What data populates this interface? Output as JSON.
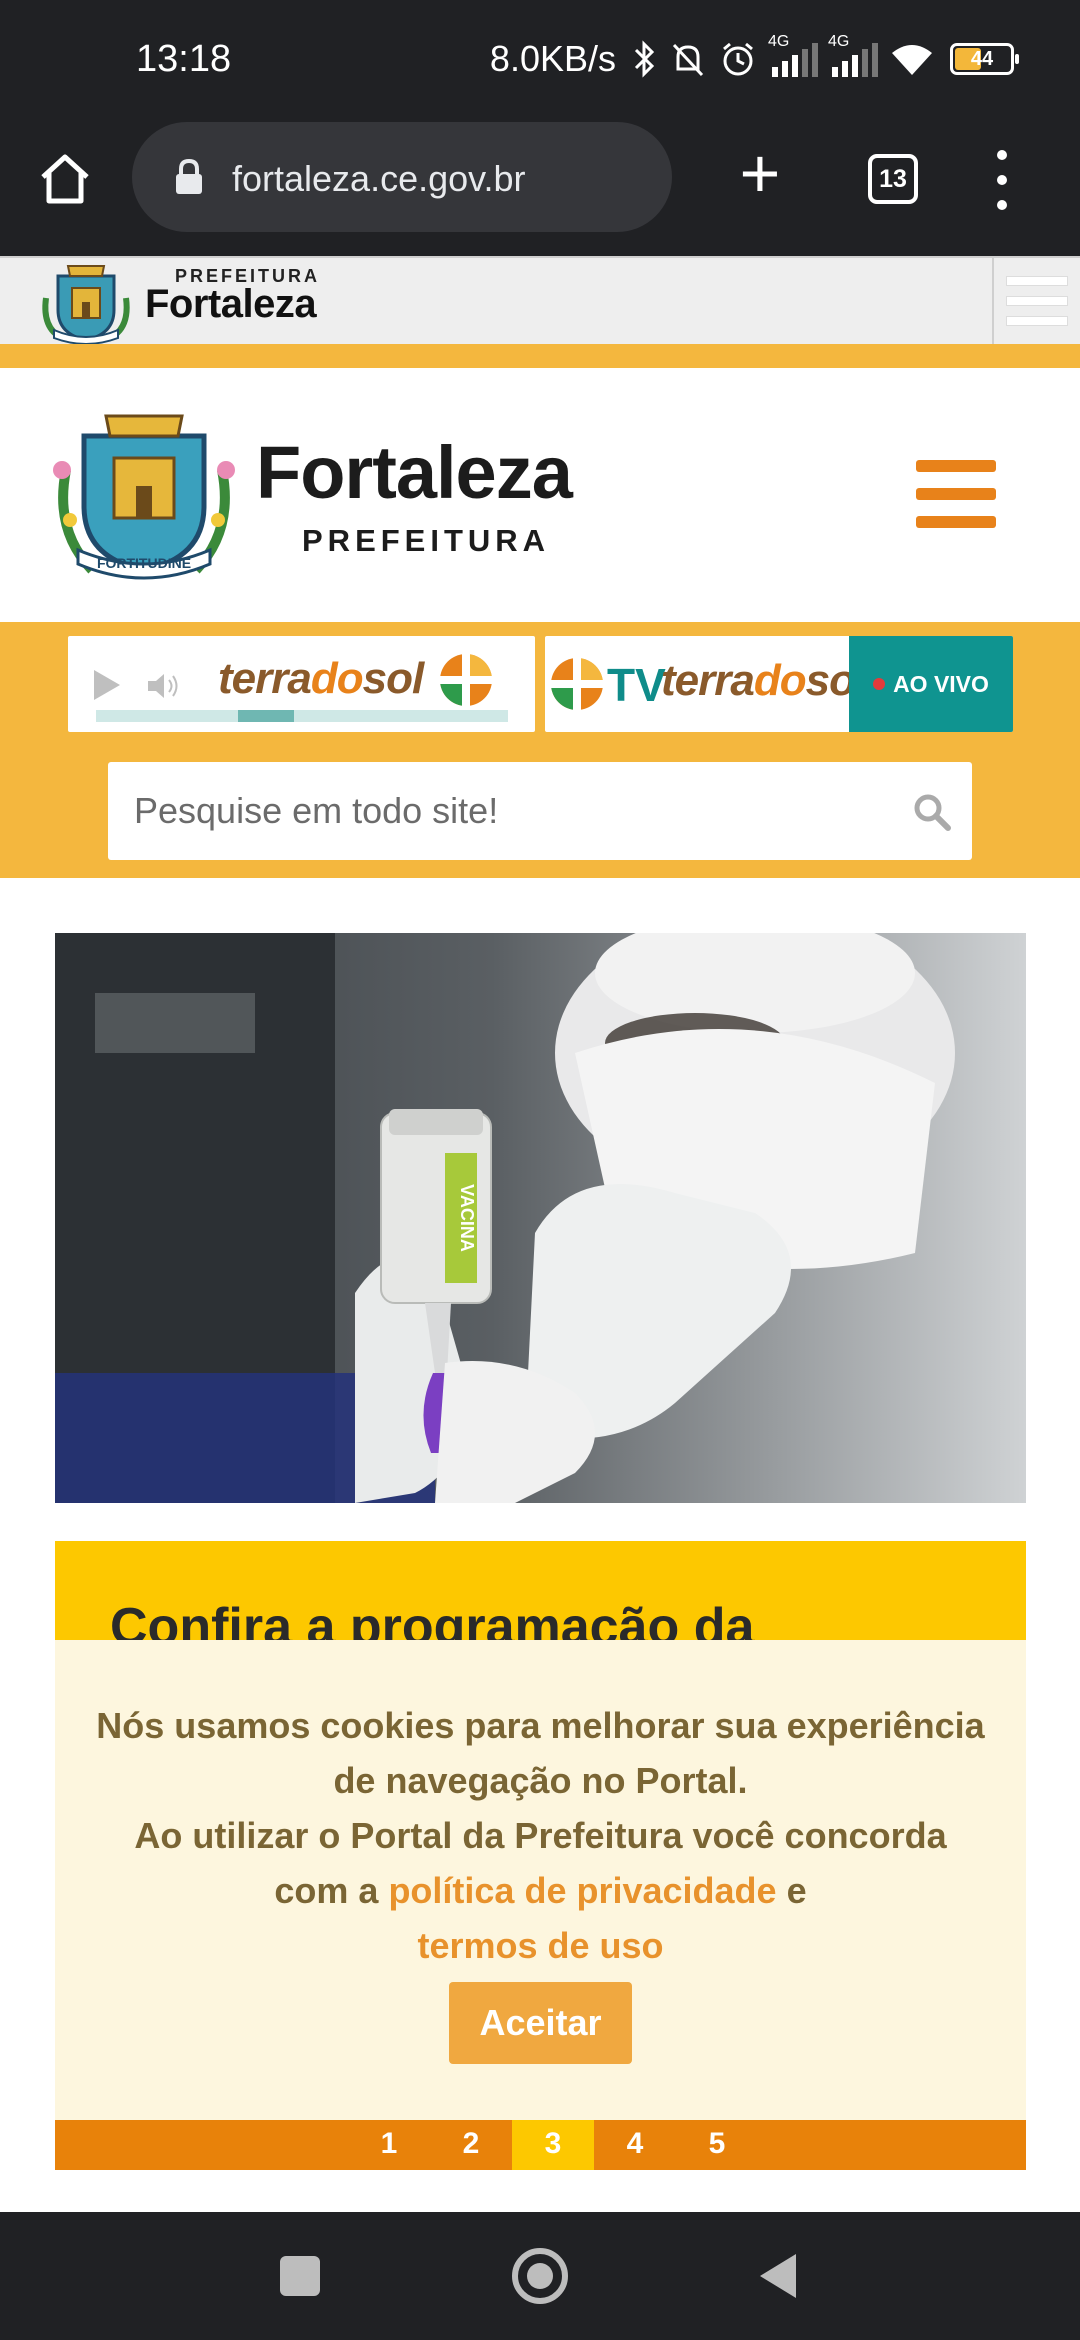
{
  "status_bar": {
    "time": "13:18",
    "network_speed": "8.0KB/s",
    "signal_1_label": "4G",
    "signal_2_label": "4G",
    "battery": "44"
  },
  "browser": {
    "url": "fortaleza.ce.gov.br",
    "tab_count": "13"
  },
  "mini_header": {
    "prefeitura": "PREFEITURA",
    "fortaleza": "Fortaleza"
  },
  "main_header": {
    "title": "Fortaleza",
    "subtitle": "PREFEITURA",
    "crest_motto": "FORTITUDINE"
  },
  "media": {
    "radio_brand_a": "terra",
    "radio_brand_b": "do",
    "radio_brand_c": "sol",
    "tv_prefix": "TV",
    "tv_brand_a": "terra",
    "tv_brand_b": "do",
    "tv_brand_c": "sol",
    "live_label": "AO VIVO"
  },
  "search": {
    "placeholder": "Pesquise em todo site!"
  },
  "slide": {
    "title": "Confira a programação da",
    "vial_label": "VACINA"
  },
  "pager": {
    "pages": [
      "1",
      "2",
      "3",
      "4",
      "5"
    ],
    "active": "3"
  },
  "cookie": {
    "line1": "Nós usamos cookies para melhorar sua experiência de navegação no Portal.",
    "line2": "Ao utilizar o Portal da Prefeitura você concorda com a",
    "privacy_link": "política de privacidade",
    "conjunction": "e",
    "terms_link": "termos de uso",
    "accept_label": "Aceitar"
  },
  "colors": {
    "accent_orange": "#e8821a",
    "band_yellow": "#f4b73e",
    "caption_yellow": "#fdc800",
    "teal": "#0f9490"
  }
}
